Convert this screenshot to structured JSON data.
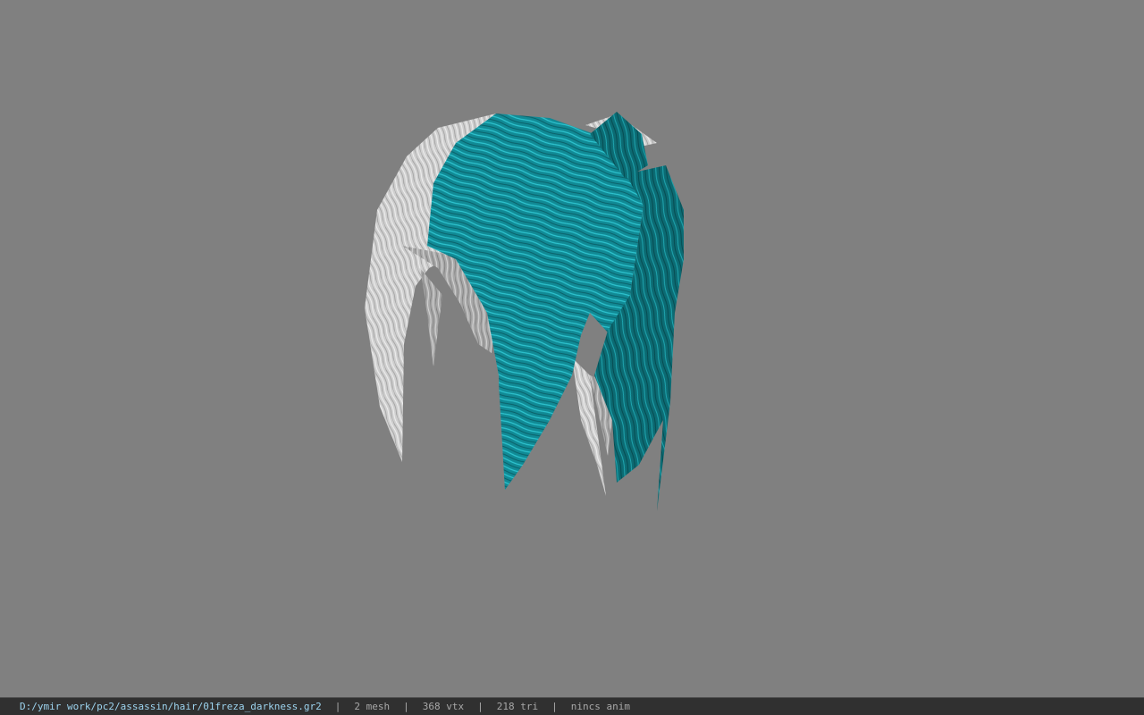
{
  "viewer": {
    "background_color": "#808080",
    "model": {
      "icon": "hair-mesh-model",
      "primary_color": "#1aa3ad",
      "secondary_color": "#dcdcdc"
    }
  },
  "statusbar": {
    "file_path": "D:/ymir work/pc2/assassin/hair/01freza_darkness.gr2",
    "separator": "|",
    "mesh_count": "2 mesh",
    "vertex_count": "368 vtx",
    "triangle_count": "218 tri",
    "anim_status": "nincs anim"
  }
}
